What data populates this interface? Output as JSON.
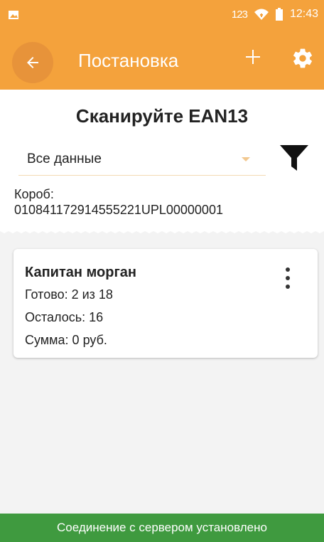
{
  "status_bar": {
    "indicator": "123",
    "time": "12:43"
  },
  "app_bar": {
    "title": "Постановка"
  },
  "main": {
    "heading": "Сканируйте EAN13",
    "filter_select": {
      "value": "Все данные"
    },
    "box_label": "Короб:",
    "box_code": "010841172914555221UPL00000001"
  },
  "card": {
    "name": "Капитан морган",
    "ready": "Готово: 2 из 18",
    "remaining": "Осталось: 16",
    "sum": "Сумма: 0 руб."
  },
  "footer": {
    "status": "Соединение с сервером установлено"
  },
  "colors": {
    "accent": "#f4a23c",
    "footer": "#3f9a3f"
  }
}
